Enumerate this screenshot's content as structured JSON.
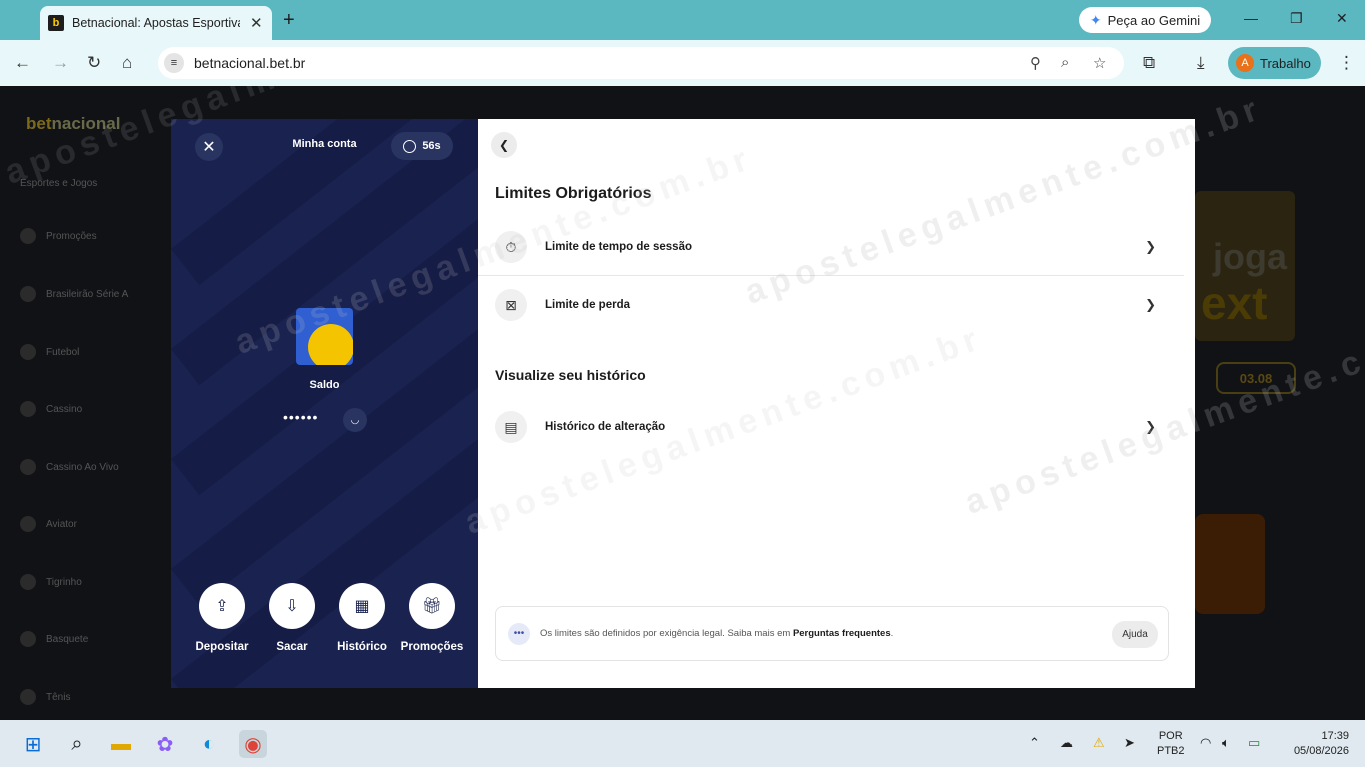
{
  "browser": {
    "tab_title": "Betnacional: Apostas Esportivas",
    "gemini_label": "Peça ao Gemini",
    "url": "betnacional.bet.br",
    "profile_initial": "A",
    "profile_label": "Trabalho"
  },
  "site": {
    "logo_bet": "bet",
    "logo_nacional": "nacional",
    "sidebar_title": "Esportes e Jogos",
    "sidebar_items": [
      "Promoções",
      "Brasileirão Série A",
      "Futebol",
      "Cassino",
      "Cassino Ao Vivo",
      "Aviator",
      "Tigrinho",
      "Basquete",
      "Tênis"
    ],
    "banner_word": "joga",
    "banner_letters": "ext",
    "banner_date": "03.08"
  },
  "account": {
    "title": "Minha conta",
    "timer": "56s",
    "balance_label": "Saldo",
    "balance_masked": "••••••",
    "actions": [
      {
        "label": "Depositar",
        "icon": "deposit-icon"
      },
      {
        "label": "Sacar",
        "icon": "withdraw-icon"
      },
      {
        "label": "Histórico",
        "icon": "calendar-icon"
      },
      {
        "label": "Promoções",
        "icon": "gift-icon"
      }
    ]
  },
  "limits": {
    "heading": "Limites Obrigatórios",
    "items": [
      {
        "label": "Limite de tempo de sessão",
        "icon": "stopwatch-icon"
      },
      {
        "label": "Limite de perda",
        "icon": "money-loss-icon"
      }
    ],
    "history_heading": "Visualize seu histórico",
    "history_item": "Histórico de alteração",
    "info_text": "Os limites são definidos por exigência legal. Saiba mais em ",
    "info_link": "Perguntas frequentes",
    "info_end": ".",
    "help_label": "Ajuda"
  },
  "watermark": "apostelegalmente.com.br",
  "taskbar": {
    "lang_1": "POR",
    "lang_2": "PTB2",
    "time": "17:39",
    "date": "05/08/2026"
  }
}
